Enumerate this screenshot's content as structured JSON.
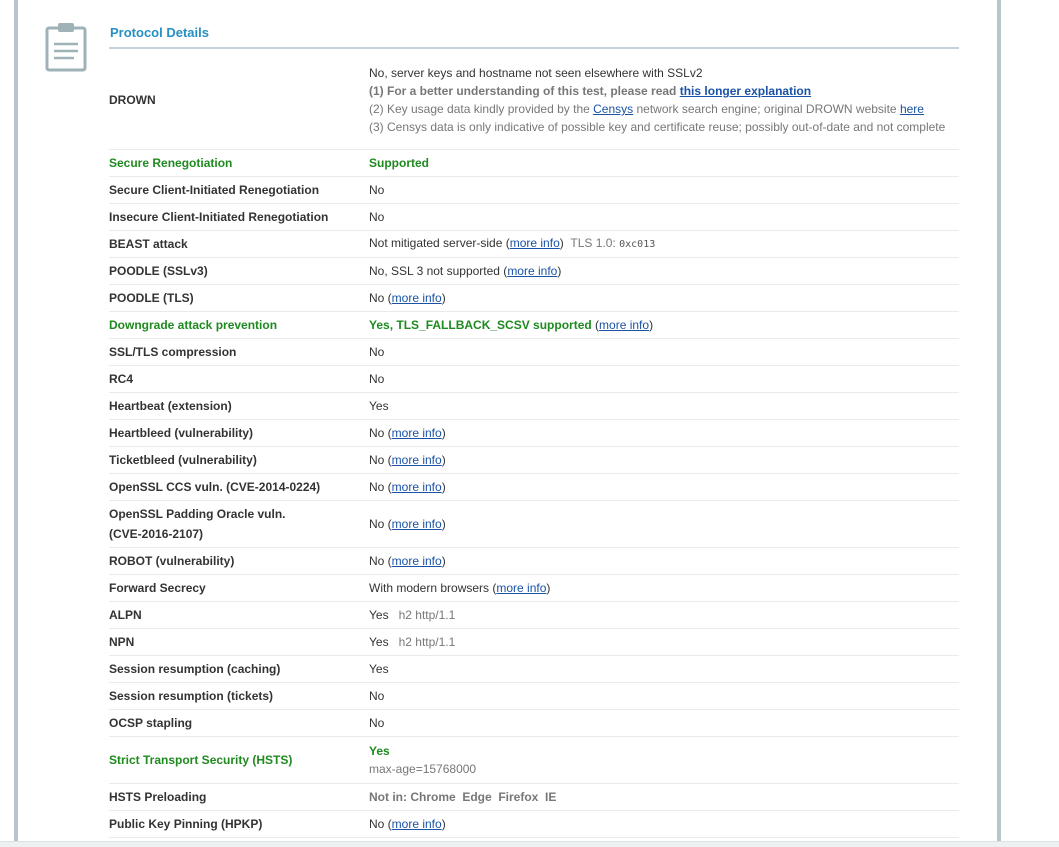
{
  "section": {
    "title": "Protocol Details"
  },
  "drown": {
    "label": "DROWN",
    "status": "No, server keys and hostname not seen elsewhere with SSLv2",
    "note1_prefix": "(1) For a better understanding of this test, please read ",
    "note1_link": "this longer explanation",
    "note2_prefix": "(2) Key usage data kindly provided by the ",
    "note2_link1": "Censys",
    "note2_mid": " network search engine; original DROWN website ",
    "note2_link2": "here",
    "note3": "(3) Censys data is only indicative of possible key and certificate reuse; possibly out-of-date and not complete"
  },
  "more_info": "more info",
  "rows": {
    "secure_reneg": {
      "label": "Secure Renegotiation",
      "value": "Supported"
    },
    "client_reneg": {
      "label": "Secure Client-Initiated Renegotiation",
      "value": "No"
    },
    "insecure_reneg": {
      "label": "Insecure Client-Initiated Renegotiation",
      "value": "No"
    },
    "beast": {
      "label": "BEAST attack",
      "value": "Not mitigated server-side (",
      "suffix": ")",
      "extra": "TLS 1.0: ",
      "code": "0xc013"
    },
    "poodle_ssl": {
      "label": "POODLE (SSLv3)",
      "value": "No, SSL 3 not supported (",
      "suffix": ")"
    },
    "poodle_tls": {
      "label": "POODLE (TLS)",
      "value": "No (",
      "suffix": ")"
    },
    "downgrade": {
      "label": "Downgrade attack prevention",
      "value": "Yes, TLS_FALLBACK_SCSV supported",
      "mid": " (",
      "suffix": ")"
    },
    "compression": {
      "label": "SSL/TLS compression",
      "value": "No"
    },
    "rc4": {
      "label": "RC4",
      "value": "No"
    },
    "heartbeat": {
      "label": "Heartbeat (extension)",
      "value": "Yes"
    },
    "heartbleed": {
      "label": "Heartbleed (vulnerability)",
      "value": "No (",
      "suffix": ")"
    },
    "ticketbleed": {
      "label": "Ticketbleed (vulnerability)",
      "value": "No (",
      "suffix": ")"
    },
    "ccs": {
      "label": "OpenSSL CCS vuln. (CVE-2014-0224)",
      "value": "No (",
      "suffix": ")"
    },
    "padding": {
      "label_line1": "OpenSSL Padding Oracle vuln.",
      "label_line2": "(CVE-2016-2107)",
      "value": "No (",
      "suffix": ")"
    },
    "robot": {
      "label": "ROBOT (vulnerability)",
      "value": "No (",
      "suffix": ")"
    },
    "fs": {
      "label": "Forward Secrecy",
      "value": "With modern browsers (",
      "suffix": ")"
    },
    "alpn": {
      "label": "ALPN",
      "value": "Yes",
      "extra": "h2 http/1.1"
    },
    "npn": {
      "label": "NPN",
      "value": "Yes",
      "extra": "h2 http/1.1"
    },
    "sess_cache": {
      "label": "Session resumption (caching)",
      "value": "Yes"
    },
    "sess_tickets": {
      "label": "Session resumption (tickets)",
      "value": "No"
    },
    "ocsp": {
      "label": "OCSP stapling",
      "value": "No"
    },
    "hsts": {
      "label": "Strict Transport Security (HSTS)",
      "value": "Yes",
      "extra": "max-age=15768000"
    },
    "hsts_preload": {
      "label": "HSTS Preloading",
      "value": "Not in: Chrome  Edge  Firefox  IE"
    },
    "hpkp": {
      "label": "Public Key Pinning (HPKP)",
      "value": "No (",
      "suffix": ")"
    }
  },
  "colors": {
    "accent": "#2590c3",
    "good": "#1f8a1f",
    "link": "#1a52a5",
    "frame": "#b6c6ca"
  },
  "icons": {
    "section_icon": "clipboard-icon"
  }
}
